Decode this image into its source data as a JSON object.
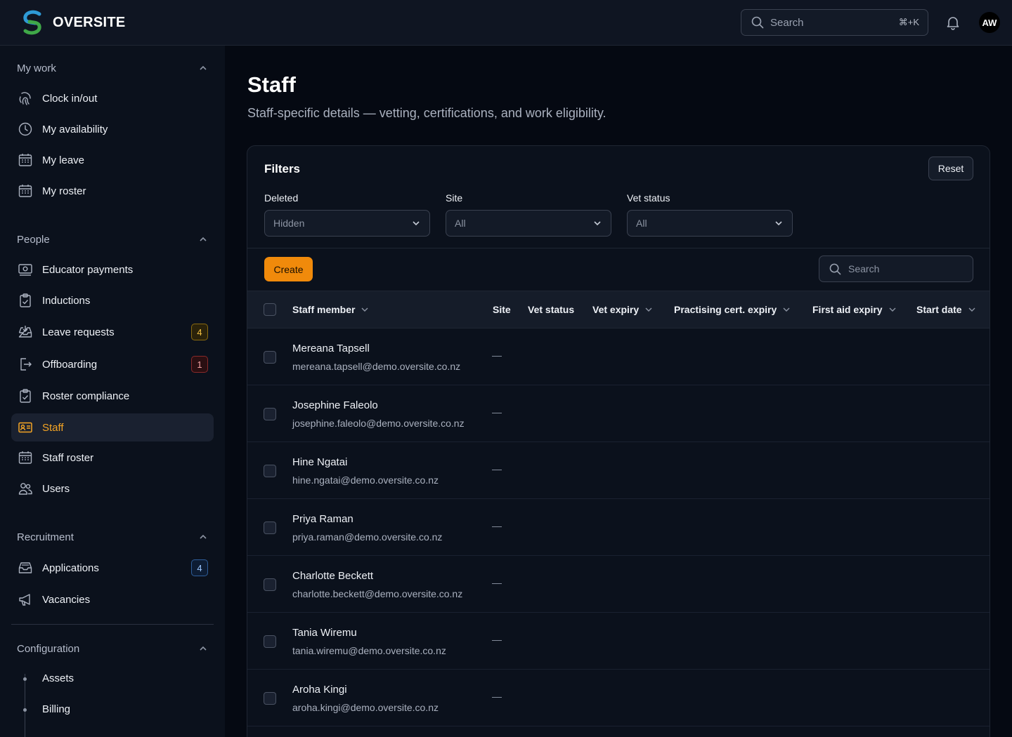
{
  "brand": {
    "name": "OVERSITE"
  },
  "header": {
    "search_placeholder": "Search",
    "shortcut": "⌘+K",
    "avatar_initials": "AW"
  },
  "sidebar": {
    "my_work": {
      "title": "My work",
      "items": [
        {
          "label": "Clock in/out",
          "icon": "fingerprint-icon"
        },
        {
          "label": "My availability",
          "icon": "clock-icon"
        },
        {
          "label": "My leave",
          "icon": "calendar-icon"
        },
        {
          "label": "My roster",
          "icon": "calendar-icon"
        }
      ]
    },
    "people": {
      "title": "People",
      "items": [
        {
          "label": "Educator payments",
          "icon": "payment-icon"
        },
        {
          "label": "Inductions",
          "icon": "clipboard-icon"
        },
        {
          "label": "Leave requests",
          "icon": "inbox-download-icon",
          "badge": "4"
        },
        {
          "label": "Offboarding",
          "icon": "logout-icon",
          "badge": "1"
        },
        {
          "label": "Roster compliance",
          "icon": "clipboard-check-icon"
        },
        {
          "label": "Staff",
          "icon": "id-card-icon"
        },
        {
          "label": "Staff roster",
          "icon": "calendar-icon"
        },
        {
          "label": "Users",
          "icon": "users-icon"
        }
      ]
    },
    "recruitment": {
      "title": "Recruitment",
      "items": [
        {
          "label": "Applications",
          "icon": "inbox-icon",
          "badge": "4"
        },
        {
          "label": "Vacancies",
          "icon": "megaphone-icon"
        }
      ]
    },
    "configuration": {
      "title": "Configuration",
      "items": [
        {
          "label": "Assets"
        },
        {
          "label": "Billing"
        }
      ]
    }
  },
  "page": {
    "title": "Staff",
    "subtitle": "Staff-specific details — vetting, certifications, and work eligibility."
  },
  "filters": {
    "title": "Filters",
    "reset_label": "Reset",
    "deleted": {
      "label": "Deleted",
      "value": "Hidden"
    },
    "site": {
      "label": "Site",
      "value": "All"
    },
    "vet_status": {
      "label": "Vet status",
      "value": "All"
    }
  },
  "toolbar": {
    "create_label": "Create",
    "search_placeholder": "Search"
  },
  "table": {
    "columns": [
      "Staff member",
      "Site",
      "Vet status",
      "Vet expiry",
      "Practising cert. expiry",
      "First aid expiry",
      "Start date"
    ],
    "rows": [
      {
        "name": "Mereana Tapsell",
        "email": "mereana.tapsell@demo.oversite.co.nz",
        "site": "—"
      },
      {
        "name": "Josephine Faleolo",
        "email": "josephine.faleolo@demo.oversite.co.nz",
        "site": "—"
      },
      {
        "name": "Hine Ngatai",
        "email": "hine.ngatai@demo.oversite.co.nz",
        "site": "—"
      },
      {
        "name": "Priya Raman",
        "email": "priya.raman@demo.oversite.co.nz",
        "site": "—"
      },
      {
        "name": "Charlotte Beckett",
        "email": "charlotte.beckett@demo.oversite.co.nz",
        "site": "—"
      },
      {
        "name": "Tania Wiremu",
        "email": "tania.wiremu@demo.oversite.co.nz",
        "site": "—"
      },
      {
        "name": "Aroha Kingi",
        "email": "aroha.kingi@demo.oversite.co.nz",
        "site": "—"
      }
    ]
  },
  "colors": {
    "accent": "#f5a524",
    "create_button": "#f08a0b",
    "background": "#050912"
  }
}
